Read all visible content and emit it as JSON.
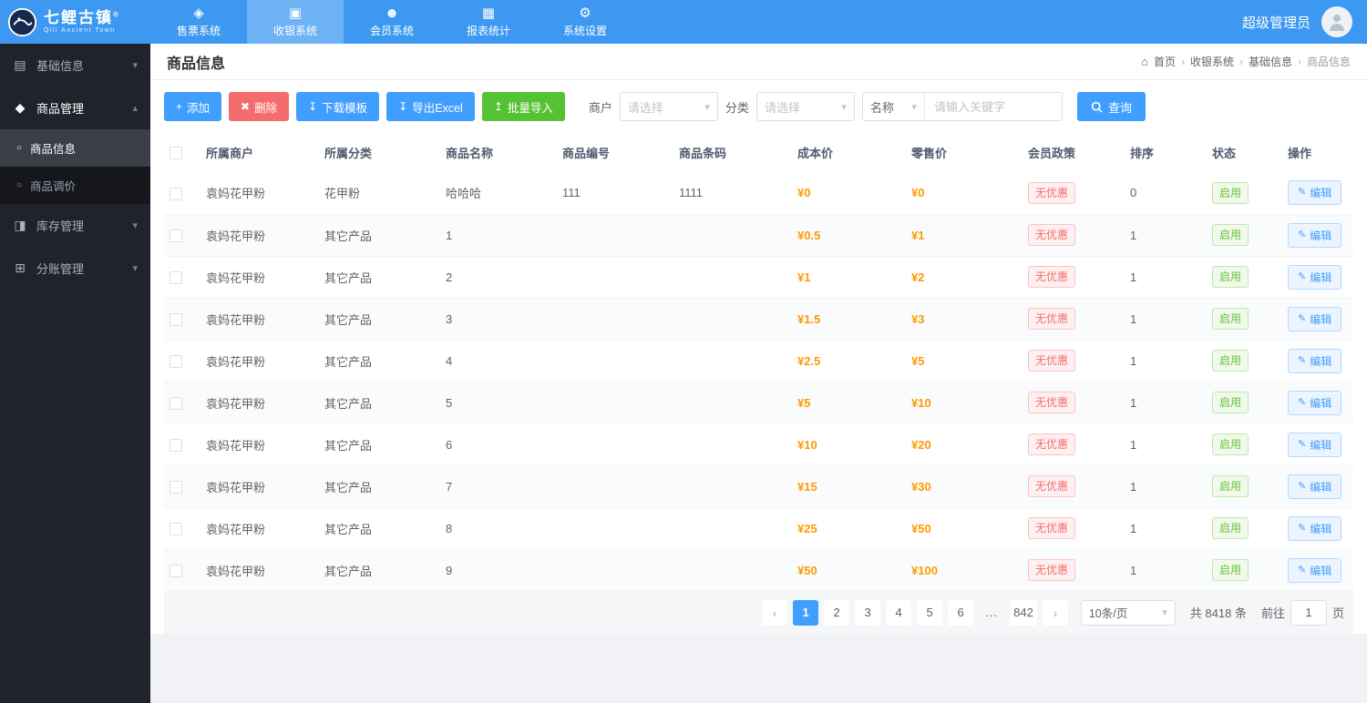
{
  "colors": {
    "primary": "#409eff",
    "danger": "#f56c6c",
    "success": "#55c234",
    "price_orange": "#ff9900",
    "header_bg": "#3c98f0",
    "sidebar_bg": "#20232b"
  },
  "icons": {
    "ticket-icon": "◈",
    "cashier-icon": "▣",
    "member-icon": "☻",
    "report-icon": "▦",
    "settings-icon": "⚙",
    "info-icon": "▤",
    "product-icon": "◆",
    "stock-icon": "◨",
    "ledger-icon": "⊞",
    "dot-icon": "○",
    "chevron-down-icon": "▾",
    "chevron-up-icon": "▴",
    "plus-icon": "+",
    "trash-icon": "✖",
    "download-icon": "↧",
    "upload-icon": "↥",
    "edit-icon": "✎",
    "home-icon": "⌂",
    "breadcrumb-separator": "›",
    "chevron-left-icon": "‹",
    "chevron-right-icon": "›",
    "select-chevron": "▾"
  },
  "header": {
    "brand_title": "七鲤古镇",
    "brand_mark": "®",
    "brand_subtitle": "Qili Ancient Town",
    "nav": [
      {
        "label": "售票系统",
        "icon": "ticket-icon",
        "active": false
      },
      {
        "label": "收银系统",
        "icon": "cashier-icon",
        "active": true
      },
      {
        "label": "会员系统",
        "icon": "member-icon",
        "active": false
      },
      {
        "label": "报表统计",
        "icon": "report-icon",
        "active": false
      },
      {
        "label": "系统设置",
        "icon": "settings-icon",
        "active": false
      }
    ],
    "user_name": "超级管理员"
  },
  "sidebar": {
    "items": [
      {
        "label": "基础信息",
        "icon": "info-icon",
        "expanded": false,
        "active": false,
        "children": []
      },
      {
        "label": "商品管理",
        "icon": "product-icon",
        "expanded": true,
        "active": true,
        "children": [
          {
            "label": "商品信息",
            "active": true
          },
          {
            "label": "商品调价",
            "active": false
          }
        ]
      },
      {
        "label": "库存管理",
        "icon": "stock-icon",
        "expanded": false,
        "active": false,
        "children": []
      },
      {
        "label": "分账管理",
        "icon": "ledger-icon",
        "expanded": false,
        "active": false,
        "children": []
      }
    ]
  },
  "page": {
    "title": "商品信息",
    "breadcrumb": [
      "首页",
      "收银系统",
      "基础信息",
      "商品信息"
    ]
  },
  "toolbar": {
    "buttons": [
      {
        "name": "add",
        "label": "添加",
        "icon": "plus-icon",
        "type": "primary"
      },
      {
        "name": "delete",
        "label": "删除",
        "icon": "trash-icon",
        "type": "danger"
      },
      {
        "name": "download-template",
        "label": "下载模板",
        "icon": "download-icon",
        "type": "primary"
      },
      {
        "name": "export-excel",
        "label": "导出Excel",
        "icon": "download-icon",
        "type": "primary"
      },
      {
        "name": "batch-import",
        "label": "批量导入",
        "icon": "upload-icon",
        "type": "success"
      }
    ],
    "filters": {
      "merchant_label": "商户",
      "merchant_placeholder": "请选择",
      "category_label": "分类",
      "category_placeholder": "请选择",
      "field_select": "名称",
      "keyword_placeholder": "请输入关键字",
      "search_label": "查询"
    }
  },
  "table": {
    "columns": [
      "所属商户",
      "所属分类",
      "商品名称",
      "商品编号",
      "商品条码",
      "成本价",
      "零售价",
      "会员政策",
      "排序",
      "状态",
      "操作"
    ],
    "rows": [
      {
        "merchant": "袁妈花甲粉",
        "category": "花甲粉",
        "name": "哈哈哈",
        "code": "111",
        "barcode": "1111",
        "cost": "¥0",
        "retail": "¥0",
        "policy": "无优惠",
        "sort": "0",
        "status": "启用",
        "action": "编辑"
      },
      {
        "merchant": "袁妈花甲粉",
        "category": "其它产品",
        "name": "1",
        "code": "",
        "barcode": "",
        "cost": "¥0.5",
        "retail": "¥1",
        "policy": "无优惠",
        "sort": "1",
        "status": "启用",
        "action": "编辑"
      },
      {
        "merchant": "袁妈花甲粉",
        "category": "其它产品",
        "name": "2",
        "code": "",
        "barcode": "",
        "cost": "¥1",
        "retail": "¥2",
        "policy": "无优惠",
        "sort": "1",
        "status": "启用",
        "action": "编辑"
      },
      {
        "merchant": "袁妈花甲粉",
        "category": "其它产品",
        "name": "3",
        "code": "",
        "barcode": "",
        "cost": "¥1.5",
        "retail": "¥3",
        "policy": "无优惠",
        "sort": "1",
        "status": "启用",
        "action": "编辑"
      },
      {
        "merchant": "袁妈花甲粉",
        "category": "其它产品",
        "name": "4",
        "code": "",
        "barcode": "",
        "cost": "¥2.5",
        "retail": "¥5",
        "policy": "无优惠",
        "sort": "1",
        "status": "启用",
        "action": "编辑"
      },
      {
        "merchant": "袁妈花甲粉",
        "category": "其它产品",
        "name": "5",
        "code": "",
        "barcode": "",
        "cost": "¥5",
        "retail": "¥10",
        "policy": "无优惠",
        "sort": "1",
        "status": "启用",
        "action": "编辑"
      },
      {
        "merchant": "袁妈花甲粉",
        "category": "其它产品",
        "name": "6",
        "code": "",
        "barcode": "",
        "cost": "¥10",
        "retail": "¥20",
        "policy": "无优惠",
        "sort": "1",
        "status": "启用",
        "action": "编辑"
      },
      {
        "merchant": "袁妈花甲粉",
        "category": "其它产品",
        "name": "7",
        "code": "",
        "barcode": "",
        "cost": "¥15",
        "retail": "¥30",
        "policy": "无优惠",
        "sort": "1",
        "status": "启用",
        "action": "编辑"
      },
      {
        "merchant": "袁妈花甲粉",
        "category": "其它产品",
        "name": "8",
        "code": "",
        "barcode": "",
        "cost": "¥25",
        "retail": "¥50",
        "policy": "无优惠",
        "sort": "1",
        "status": "启用",
        "action": "编辑"
      },
      {
        "merchant": "袁妈花甲粉",
        "category": "其它产品",
        "name": "9",
        "code": "",
        "barcode": "",
        "cost": "¥50",
        "retail": "¥100",
        "policy": "无优惠",
        "sort": "1",
        "status": "启用",
        "action": "编辑"
      }
    ]
  },
  "pagination": {
    "pages": [
      "1",
      "2",
      "3",
      "4",
      "5",
      "6",
      "...",
      "842"
    ],
    "active_page": "1",
    "page_size": "10条/页",
    "total": "共 8418 条",
    "goto_prefix": "前往",
    "goto_value": "1",
    "goto_suffix": "页"
  }
}
